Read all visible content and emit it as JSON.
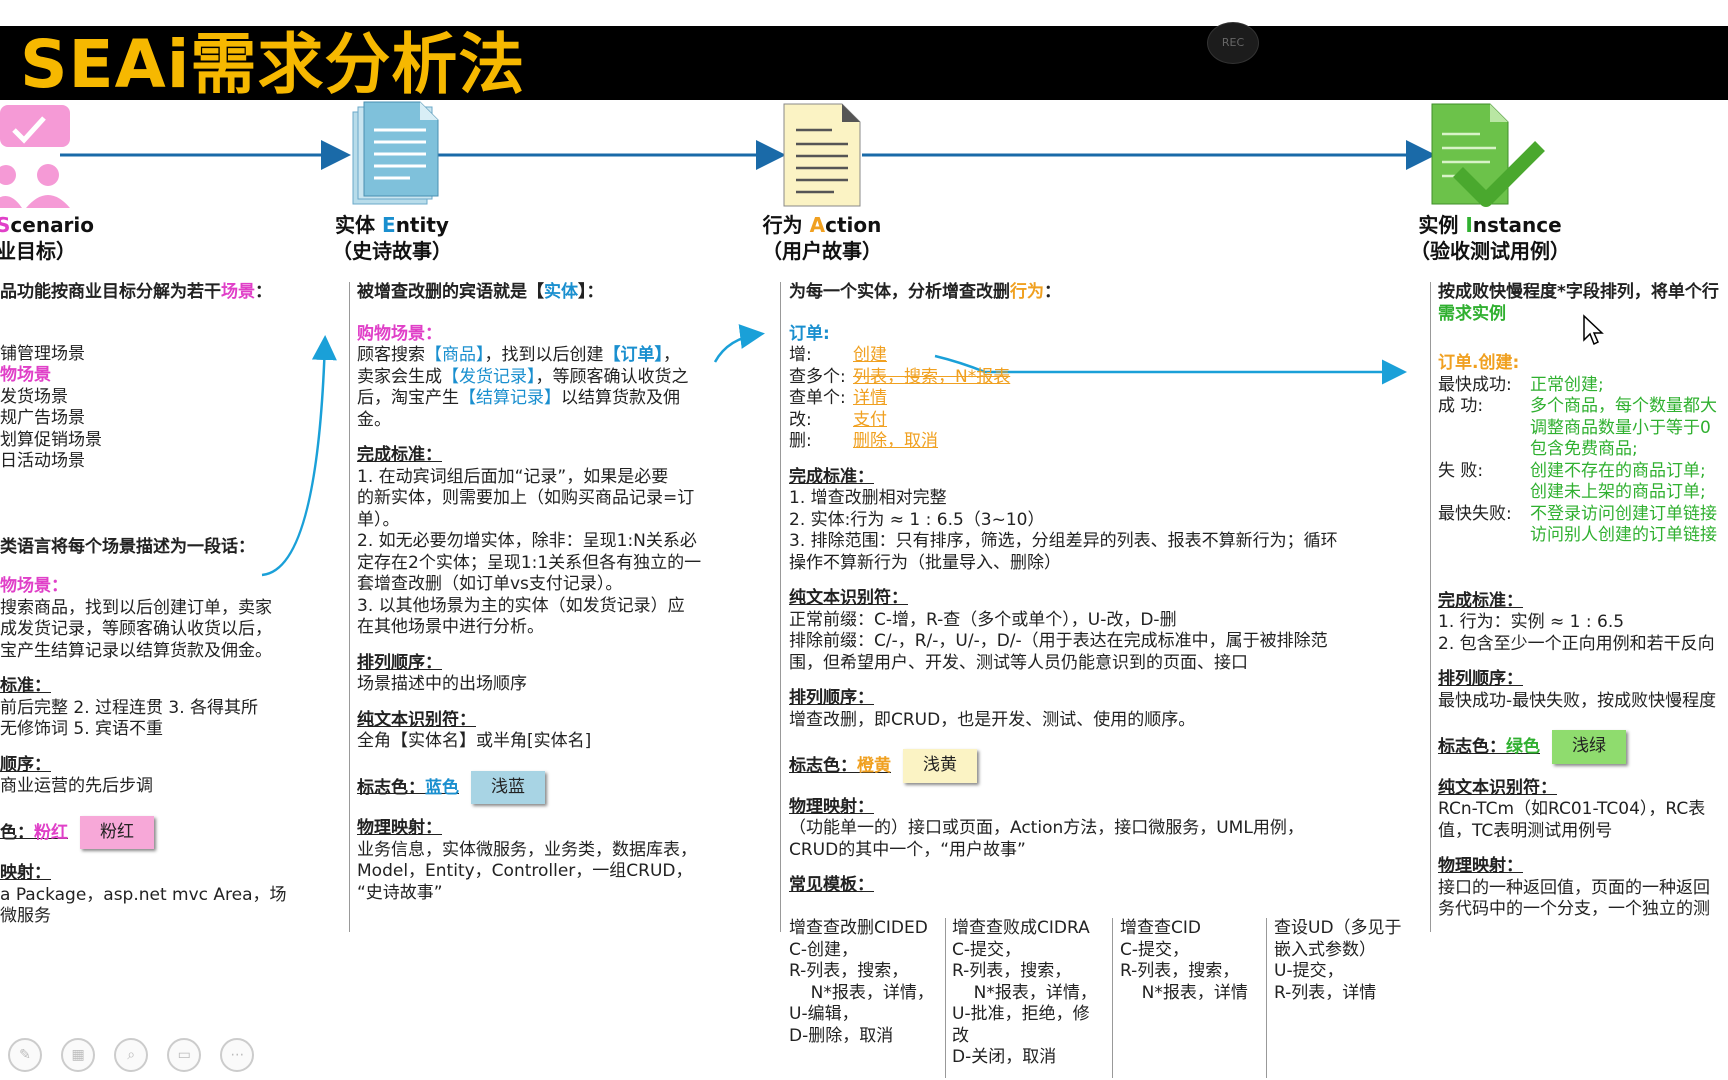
{
  "title": "SEAi需求分析法",
  "stages": [
    {
      "name": "Scenario",
      "first": "S",
      "rest": "cenario",
      "prefix": "",
      "sub": "业目标）",
      "color": "#e040c8"
    },
    {
      "prefix": "实体 ",
      "first": "E",
      "rest": "ntity",
      "sub": "（史诗故事）",
      "color": "#1a8fcf"
    },
    {
      "prefix": "行为 ",
      "first": "A",
      "rest": "ction",
      "sub": "（用户故事）",
      "color": "#f0a020"
    },
    {
      "prefix": "实例 ",
      "first": "I",
      "rest": "nstance",
      "sub": "（验收测试用例）",
      "color": "#30b030"
    }
  ],
  "col1": {
    "header": "品功能按商业目标分解为若干",
    "header_hl": "场景",
    "header_end": "：",
    "items": [
      "铺管理场景",
      "物场景",
      "发货场景",
      "规广告场景",
      "划算促销场景",
      "日活动场景"
    ],
    "para_hdr": "类语言将每个场景描述为一段话：",
    "sc_label": "物场景：",
    "sc_lines": [
      "搜索商品，找到以后创建订单，卖家",
      "成发货记录，等顾客确认收货以后，",
      "宝产生结算记录以结算货款及佣金。"
    ],
    "std_title": "标准：",
    "std_lines": [
      "前后完整   2. 过程连贯   3. 各得其所",
      "无修饰词   5. 宾语不重"
    ],
    "order_title": "顺序：",
    "order_text": "商业运营的先后步调",
    "color_title": "色：",
    "color_name": "粉红",
    "swatch": "粉红",
    "map_title": "映射：",
    "map_lines": [
      "a Package，asp.net mvc Area，场",
      "微服务"
    ]
  },
  "col2": {
    "header": "被增查改删的宾语就是【",
    "header_hl": "实体",
    "header_end": "】：",
    "sc_label": "购物场景：",
    "sc_lines": [
      [
        "顾客搜索",
        "【商品】",
        "，找到以后创建",
        "【订单】",
        "，"
      ],
      [
        "卖家会生成",
        "【发货记录】",
        "，等顾客确认收货之",
        "",
        ""
      ],
      [
        "后，淘宝产生",
        "【结算记录】",
        "以结算货款及佣",
        "",
        ""
      ],
      [
        "金。",
        "",
        "",
        "",
        ""
      ]
    ],
    "std_title": "完成标准：",
    "std_lines": [
      "1. 在动宾词组后面加“记录”，如果是必要",
      "的新实体，则需要加上（如购买商品记录=订",
      "单）。",
      "2. 如无必要勿增实体，除非：呈现1:N关系必",
      "定存在2个实体；呈现1:1关系但各有独立的一",
      "套增查改删（如订单vs支付记录）。",
      "3. 以其他场景为主的实体（如发货记录）应",
      "在其他场景中进行分析。"
    ],
    "order_title": "排列顺序：",
    "order_text": "场景描述中的出场顺序",
    "id_title": "纯文本识别符：",
    "id_text": "全角【实体名】或半角[实体名]",
    "color_title": "标志色：",
    "color_name": "蓝色",
    "swatch": "浅蓝",
    "map_title": "物理映射：",
    "map_lines": [
      "业务信息，实体微服务，业务类，数据库表，",
      "Model，Entity，Controller，一组CRUD，",
      "“史诗故事”"
    ]
  },
  "col3": {
    "header": "为每一个实体，分析增查改删",
    "header_hl": "行为",
    "header_end": "：",
    "entity": "订单:",
    "ops": [
      {
        "k": "增:",
        "v": "创建",
        "strike": false
      },
      {
        "k": "查多个:",
        "v": "列表，搜索，N*报表",
        "strike": true
      },
      {
        "k": "查单个:",
        "v": "详情",
        "strike": false
      },
      {
        "k": "改:",
        "v": "支付",
        "strike": false
      },
      {
        "k": "删:",
        "v": "删除，取消",
        "strike": false
      }
    ],
    "std_title": "完成标准：",
    "std_lines": [
      "1. 增查改删相对完整",
      "2. 实体:行为 ≈ 1 : 6.5（3~10）",
      "3. 排除范围：只有排序，筛选，分组差异的列表、报表不算新行为；循环",
      "操作不算新行为（批量导入、删除）"
    ],
    "id_title": "纯文本识别符：",
    "id_lines": [
      "正常前缀：C-增，R-查（多个或单个），U-改，D-删",
      "排除前缀：C/-，R/-，U/-，D/-（用于表达在完成标准中，属于被排除范",
      "围，但希望用户、开发、测试等人员仍能意识到的页面、接口"
    ],
    "order_title": "排列顺序：",
    "order_text": "增查改删，即CRUD，也是开发、测试、使用的顺序。",
    "color_title": "标志色：",
    "color_name": "橙黄",
    "swatch": "浅黄",
    "map_title": "物理映射：",
    "map_lines": [
      "（功能单一的）接口或页面，Action方法，接口微服务，UML用例，",
      "CRUD的其中一个，“用户故事”"
    ],
    "tpl_title": "常见模板：",
    "templates": [
      [
        "增查查改删CIDED",
        "C-创建，",
        "R-列表，搜索，",
        "    N*报表，详情，",
        "U-编辑，",
        "D-删除，取消"
      ],
      [
        "增查查败成CIDRA",
        "C-提交，",
        "R-列表，搜索，",
        "    N*报表，详情，",
        "U-批准，拒绝，修",
        "改",
        "D-关闭，取消"
      ],
      [
        "增查查CID",
        "C-提交，",
        "R-列表，搜索，",
        "    N*报表，详情"
      ],
      [
        "查设UD（多见于",
        "嵌入式参数）",
        "U-提交，",
        "R-列表，详情"
      ]
    ]
  },
  "col4": {
    "header": "按成败快慢程度*字段排列，将单个行",
    "header2": "需求实例",
    "label": "订单.创建:",
    "rows": [
      {
        "k": "最快成功:",
        "v": [
          "正常创建;"
        ]
      },
      {
        "k": "成      功:",
        "v": [
          "多个商品，每个数量都大",
          "调整商品数量小于等于0",
          "包含免费商品;"
        ]
      },
      {
        "k": "失      败:",
        "v": [
          "创建不存在的商品订单;",
          "创建未上架的商品订单;"
        ]
      },
      {
        "k": "最快失败:",
        "v": [
          "不登录访问创建订单链接",
          "访问别人创建的订单链接"
        ]
      }
    ],
    "std_title": "完成标准：",
    "std_lines": [
      "1. 行为：实例 ≈ 1 : 6.5",
      "2. 包含至少一个正向用例和若干反向"
    ],
    "order_title": "排列顺序：",
    "order_text": "最快成功-最快失败，按成败快慢程度",
    "color_title": "标志色：",
    "color_name": "绿色",
    "swatch": "浅绿",
    "id_title": "纯文本识别符：",
    "id_lines": [
      "RCn-TCm（如RC01-TC04），RC表",
      "值，TC表明测试用例号"
    ],
    "map_title": "物理映射：",
    "map_lines": [
      "接口的一种返回值，页面的一种返回",
      "务代码中的一个分支，一个独立的测"
    ]
  },
  "rec_label": "REC",
  "toolbar": [
    "pen-icon",
    "layout-icon",
    "zoom-icon",
    "screen-icon",
    "more-icon"
  ],
  "colors": {
    "pink": "#e040c8",
    "blue": "#1a8fcf",
    "orange": "#f0a020",
    "green": "#30b030",
    "title": "#f6b800"
  }
}
